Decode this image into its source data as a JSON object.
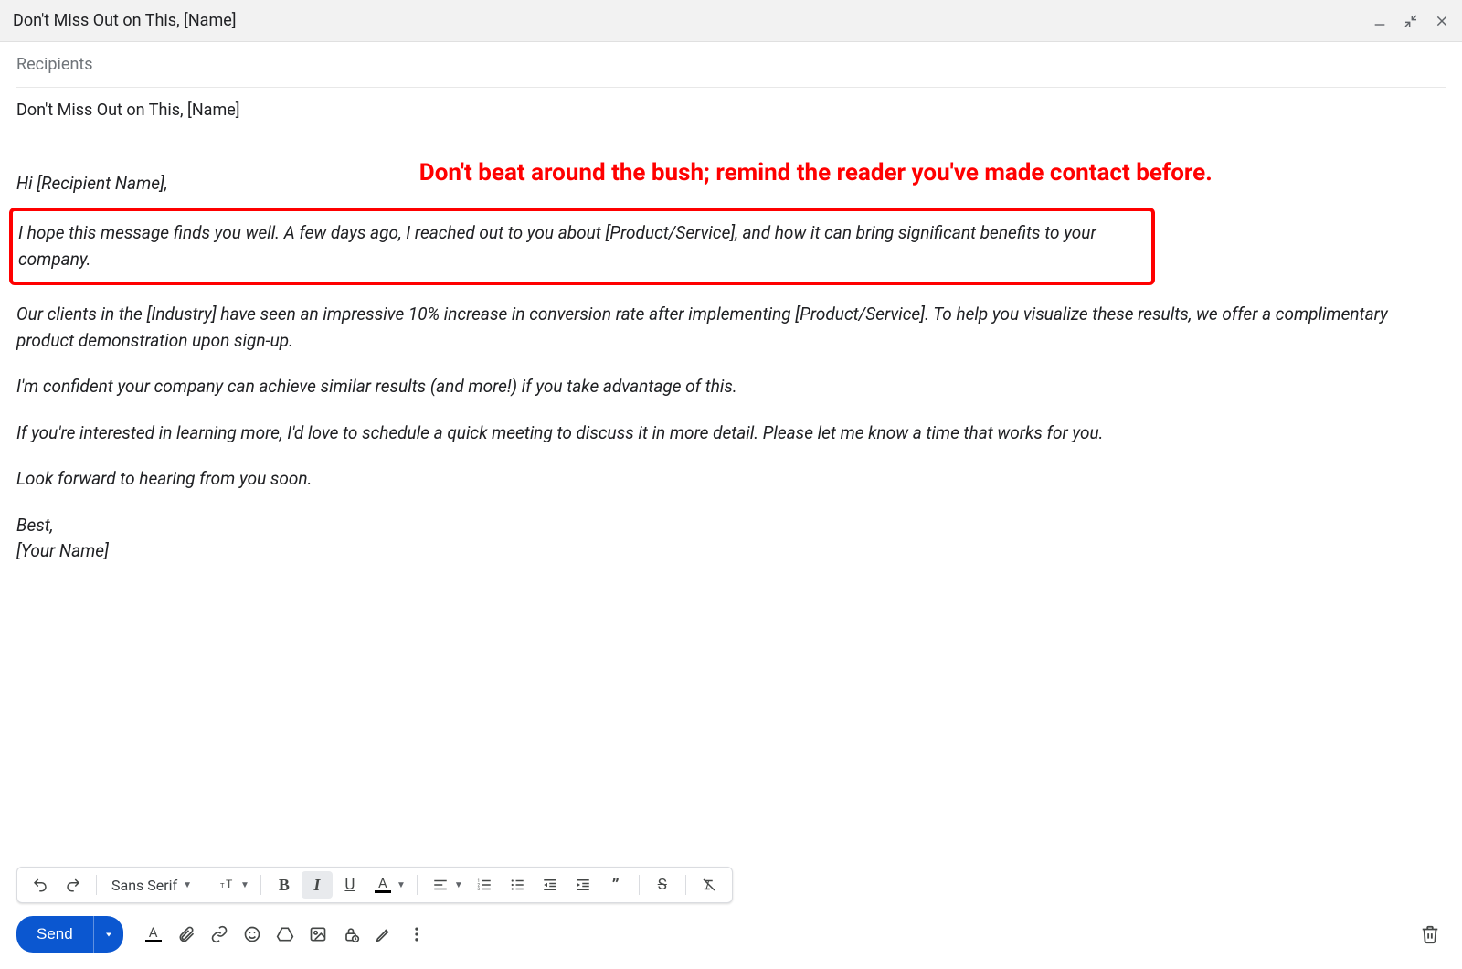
{
  "window": {
    "title": "Don't Miss Out on This, [Name]"
  },
  "compose": {
    "recipients_placeholder": "Recipients",
    "subject": "Don't Miss Out on This, [Name]"
  },
  "annotation": "Don't beat around the bush; remind the reader you've made contact before.",
  "email": {
    "greeting": "Hi [Recipient Name],",
    "p1": "I hope this message finds you well. A few days ago, I reached out to you about [Product/Service], and how it can bring significant benefits to your company.",
    "p2": "Our clients in the [Industry] have seen an impressive 10% increase in conversion rate after implementing [Product/Service]. To help you visualize these results, we offer a complimentary product demonstration upon sign-up.",
    "p3": "I'm confident your company can achieve similar results (and more!) if you take advantage of this.",
    "p4": "If you're interested in learning more, I'd love to schedule a quick meeting to discuss it in more detail. Please let me know a time that works for you.",
    "p5": "Look forward to hearing from you soon.",
    "signoff1": "Best,",
    "signoff2": "[Your Name]"
  },
  "toolbar": {
    "font": "Sans Serif",
    "send_label": "Send"
  }
}
